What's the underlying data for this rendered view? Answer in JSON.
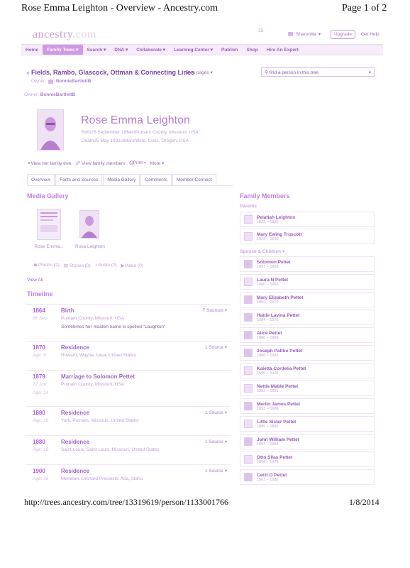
{
  "print": {
    "title": "Rose Emma Leighton - Overview - Ancestry.com",
    "page": "Page 1 of 2",
    "url": "http://trees.ancestry.com/tree/13319619/person/1133001766",
    "date": "1/8/2014"
  },
  "header": {
    "logo": "ancestry",
    "logo_suffix": ".com",
    "notifications": "25",
    "user": "Sharonlila",
    "upgrade": "Upgrade",
    "help": "Get Help"
  },
  "nav": {
    "items": [
      "Home",
      "Family Trees",
      "Search",
      "DNA",
      "Collaborate",
      "Learning Center",
      "Publish",
      "Shop",
      "Hire An Expert"
    ]
  },
  "tree": {
    "title": "Fields, Rambo, Glascock, Ottman & Connecting Lines",
    "pages_label": "Tree pages",
    "owner_label": "Owner:",
    "owner_name": "BonnieBartlettB",
    "search_placeholder": "find a person in this tree"
  },
  "person": {
    "name": "Rose Emma Leighton",
    "birth": "Birth26 September 1864inPutnam County, Missouri, USA",
    "death": "Death25 May 1931inMarshfield, Coos, Oregon, USA"
  },
  "actions": {
    "view_tree": "View her family tree",
    "view_family": "View family members",
    "print": "Print",
    "more": "More"
  },
  "tabs": [
    "Overview",
    "Facts and Sources",
    "Media Gallery",
    "Comments",
    "Member Connect"
  ],
  "media": {
    "heading": "Media Gallery",
    "items": [
      "Rose Emma...",
      "Rose Leighton"
    ],
    "photos": "Photos (2)",
    "stories": "Stories (0)",
    "audio": "Audio (0)",
    "video": "Video (0)",
    "view_all": "View All"
  },
  "timeline": {
    "heading": "Timeline",
    "events": [
      {
        "year": "1864",
        "date": "26 Sep",
        "event": "Birth",
        "place": "Putnam County, Missouri, USA",
        "note": "Sometimes her maiden name is spelled \"Laughton\"",
        "sources": "7 Sources"
      },
      {
        "year": "1870",
        "date": "Age: 6",
        "event": "Residence",
        "place": "Howard, Wayne, Iowa, United States",
        "note": "",
        "sources": "1 Source"
      },
      {
        "year": "1879",
        "date": "22 Jun",
        "age": "Age: 14",
        "event": "Marriage to Solomon Pettet",
        "place": "Putnam County, Missouri, USA",
        "note": "",
        "sources": ""
      },
      {
        "year": "1880",
        "date": "Age: 16",
        "event": "Residence",
        "place": "York, Putnam, Missouri, United States",
        "note": "",
        "sources": "1 Source"
      },
      {
        "year": "1880",
        "date": "Age: 16",
        "event": "Residence",
        "place": "Saint Louis, Saint Louis, Missouri, United States",
        "note": "",
        "sources": "1 Source"
      },
      {
        "year": "1900",
        "date": "Age: 36",
        "event": "Residence",
        "place": "Meridian, Orchard Precincts, Ada, Idaho",
        "note": "",
        "sources": "1 Source"
      }
    ]
  },
  "family": {
    "heading": "Family Members",
    "parents_label": "Parents",
    "spouse_label": "Spouse & Children",
    "parents": [
      {
        "name": "Pelatiah Leighton",
        "years": "1823 – 1882"
      },
      {
        "name": "Mary Ewing Truscott",
        "years": "1829 – 1916"
      }
    ],
    "spouse_children": [
      {
        "name": "Solomon Pettet",
        "years": "1857 – 1902"
      },
      {
        "name": "Laura N Pettet",
        "years": "1880 – 1965"
      },
      {
        "name": "Mary Elizabeth Pettet",
        "years": "1882 – 1970"
      },
      {
        "name": "Hattie Lavina Pettet",
        "years": "1884 – 1976"
      },
      {
        "name": "Alice Pettet",
        "years": "1886 – 1968"
      },
      {
        "name": "Joseph Paltire Pettet",
        "years": "1888 – 1982"
      },
      {
        "name": "Kaletta Cordelia Pettet",
        "years": "1890 – 1968"
      },
      {
        "name": "Nettie Mable Pettet",
        "years": "1892 – 1981"
      },
      {
        "name": "Merlin James Pettet",
        "years": "1893 – 1986"
      },
      {
        "name": "Little Sister Pettet",
        "years": "1895 – 1895"
      },
      {
        "name": "John William Pettet",
        "years": "1897 – 1984"
      },
      {
        "name": "Otto Silas Pettet",
        "years": "1899 – 1972"
      },
      {
        "name": "Cecil O Pettet",
        "years": "1901 – 1982"
      }
    ]
  }
}
